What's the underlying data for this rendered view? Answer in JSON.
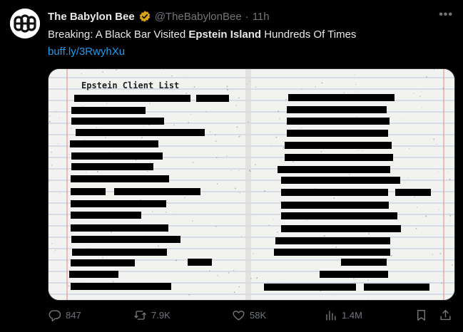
{
  "account": {
    "name": "The Babylon Bee",
    "handle": "@TheBabylonBee",
    "separator": "·",
    "time": "11h",
    "verified_color": "#d9a514"
  },
  "tweet": {
    "text_part1": "Breaking: A Black Bar Visited ",
    "text_bold": "Epstein Island",
    "text_part2": " Hundreds Of Times",
    "link": "buff.ly/3RwyhXu"
  },
  "media": {
    "document_title": "Epstein Client List",
    "paper_color": "#f2f2f0",
    "line_color": "#b9c7dd",
    "margin_line_color": "#e39a9a",
    "redaction_color": "#000000"
  },
  "actions": {
    "replies": "847",
    "reposts": "7.9K",
    "likes": "58K",
    "views": "1.4M"
  },
  "menu": {
    "more_icon": "more-icon"
  },
  "colors": {
    "background": "#000000",
    "text": "#e7e9ea",
    "muted": "#71767b",
    "link": "#1d9bf0"
  }
}
